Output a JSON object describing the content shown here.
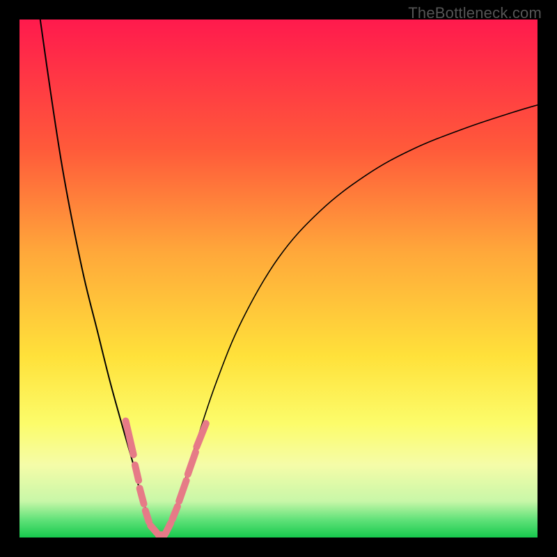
{
  "watermark": "TheBottleneck.com",
  "chart_data": {
    "type": "line",
    "title": "",
    "xlabel": "",
    "ylabel": "",
    "xlim": [
      0,
      100
    ],
    "ylim": [
      0,
      100
    ],
    "grid": false,
    "legend": false,
    "gradient_bands": [
      {
        "offset": 0.0,
        "color": "#ff1a4d"
      },
      {
        "offset": 0.25,
        "color": "#ff5a3a"
      },
      {
        "offset": 0.45,
        "color": "#ffa83a"
      },
      {
        "offset": 0.65,
        "color": "#ffe13a"
      },
      {
        "offset": 0.78,
        "color": "#fcfc6a"
      },
      {
        "offset": 0.86,
        "color": "#f5fca8"
      },
      {
        "offset": 0.93,
        "color": "#c8f7a8"
      },
      {
        "offset": 0.965,
        "color": "#62e27a"
      },
      {
        "offset": 1.0,
        "color": "#17c94d"
      }
    ],
    "series": [
      {
        "name": "left-branch",
        "stroke": "#000000",
        "stroke_width": 2.0,
        "points": [
          {
            "x": 4.0,
            "y": 100.0
          },
          {
            "x": 6.0,
            "y": 86.0
          },
          {
            "x": 8.0,
            "y": 73.0
          },
          {
            "x": 10.0,
            "y": 62.0
          },
          {
            "x": 12.5,
            "y": 50.0
          },
          {
            "x": 15.0,
            "y": 40.0
          },
          {
            "x": 17.5,
            "y": 30.0
          },
          {
            "x": 20.0,
            "y": 21.0
          },
          {
            "x": 22.0,
            "y": 14.0
          },
          {
            "x": 23.5,
            "y": 8.0
          },
          {
            "x": 25.0,
            "y": 4.0
          },
          {
            "x": 26.5,
            "y": 1.0
          },
          {
            "x": 27.5,
            "y": 0.0
          }
        ]
      },
      {
        "name": "right-branch",
        "stroke": "#000000",
        "stroke_width": 1.6,
        "points": [
          {
            "x": 27.5,
            "y": 0.0
          },
          {
            "x": 29.0,
            "y": 2.0
          },
          {
            "x": 31.0,
            "y": 8.0
          },
          {
            "x": 34.0,
            "y": 18.0
          },
          {
            "x": 38.0,
            "y": 30.0
          },
          {
            "x": 43.0,
            "y": 42.0
          },
          {
            "x": 50.0,
            "y": 54.0
          },
          {
            "x": 58.0,
            "y": 63.0
          },
          {
            "x": 67.0,
            "y": 70.0
          },
          {
            "x": 76.0,
            "y": 75.0
          },
          {
            "x": 86.0,
            "y": 79.0
          },
          {
            "x": 95.0,
            "y": 82.0
          },
          {
            "x": 100.0,
            "y": 83.5
          }
        ]
      },
      {
        "name": "left-overlay-marks",
        "stroke": "#e67a87",
        "stroke_width": 10,
        "round": true,
        "segments": [
          {
            "x1": 20.5,
            "y1": 22.5,
            "x2": 22.0,
            "y2": 16.0
          },
          {
            "x1": 22.3,
            "y1": 14.0,
            "x2": 23.0,
            "y2": 11.0
          },
          {
            "x1": 23.2,
            "y1": 9.5,
            "x2": 24.0,
            "y2": 6.5
          },
          {
            "x1": 24.3,
            "y1": 5.2,
            "x2": 25.0,
            "y2": 3.0
          },
          {
            "x1": 25.3,
            "y1": 2.3,
            "x2": 26.5,
            "y2": 0.9
          },
          {
            "x1": 26.8,
            "y1": 0.5,
            "x2": 28.0,
            "y2": 0.5
          }
        ]
      },
      {
        "name": "right-overlay-marks",
        "stroke": "#e67a87",
        "stroke_width": 10,
        "round": true,
        "segments": [
          {
            "x1": 28.2,
            "y1": 0.8,
            "x2": 29.2,
            "y2": 2.8
          },
          {
            "x1": 29.5,
            "y1": 3.5,
            "x2": 30.5,
            "y2": 6.0
          },
          {
            "x1": 30.8,
            "y1": 7.0,
            "x2": 32.2,
            "y2": 11.0
          },
          {
            "x1": 32.5,
            "y1": 12.2,
            "x2": 34.0,
            "y2": 16.5
          },
          {
            "x1": 34.2,
            "y1": 17.5,
            "x2": 36.0,
            "y2": 22.0
          }
        ]
      }
    ]
  }
}
